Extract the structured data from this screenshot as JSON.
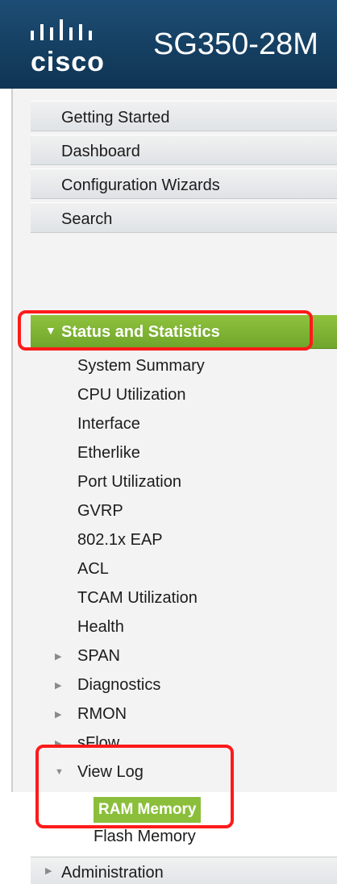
{
  "header": {
    "brand": "cisco",
    "product": "SG350-28M",
    "logo_icon": "cisco-logo-icon",
    "colors": {
      "header_bg": "#1d4d74",
      "active_green": "#8bbf3b",
      "highlight_red": "#ff1a1a"
    }
  },
  "nav": {
    "top_items": [
      {
        "label": "Getting Started"
      },
      {
        "label": "Dashboard"
      },
      {
        "label": "Configuration Wizards"
      },
      {
        "label": "Search"
      }
    ],
    "active_section": {
      "label": "Status and Statistics",
      "icon": "caret-down-icon"
    },
    "sub_items": [
      {
        "label": "System Summary"
      },
      {
        "label": "CPU Utilization"
      },
      {
        "label": "Interface"
      },
      {
        "label": "Etherlike"
      },
      {
        "label": "Port Utilization"
      },
      {
        "label": "GVRP"
      },
      {
        "label": "802.1x EAP"
      },
      {
        "label": "ACL"
      },
      {
        "label": "TCAM Utilization"
      },
      {
        "label": "Health"
      }
    ],
    "collapsed_groups": [
      {
        "label": "SPAN",
        "icon": "caret-right-icon"
      },
      {
        "label": "Diagnostics",
        "icon": "caret-right-icon"
      },
      {
        "label": "RMON",
        "icon": "caret-right-icon"
      },
      {
        "label": "sFlow",
        "icon": "caret-right-icon"
      }
    ],
    "expanded_group": {
      "label": "View Log",
      "icon": "caret-down-icon",
      "children": [
        {
          "label": "RAM Memory"
        },
        {
          "label": "Flash Memory"
        }
      ]
    },
    "bottom_item": {
      "label": "Administration",
      "icon": "caret-right-icon"
    }
  }
}
